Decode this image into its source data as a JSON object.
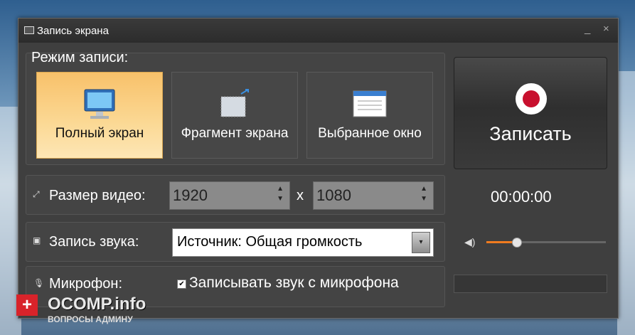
{
  "window": {
    "title": "Запись экрана",
    "minimize": "_",
    "close": "×"
  },
  "mode": {
    "label": "Режим записи:",
    "options": [
      {
        "label": "Полный экран",
        "icon": "monitor-icon",
        "active": true
      },
      {
        "label": "Фрагмент экрана",
        "icon": "screen-fragment-icon",
        "active": false
      },
      {
        "label": "Выбранное окно",
        "icon": "window-icon",
        "active": false
      }
    ]
  },
  "record": {
    "label": "Записать",
    "icon": "record-icon",
    "color": "#c8102e"
  },
  "video_size": {
    "label": "Размер видео:",
    "width": "1920",
    "height": "1080",
    "separator": "x"
  },
  "timer": "00:00:00",
  "audio": {
    "label": "Запись звука:",
    "source": "Источник: Общая громкость"
  },
  "volume": {
    "level": 0.25,
    "accent": "#f07b1f"
  },
  "mic": {
    "label": "Микрофон:",
    "checkbox_label": "Записывать звук с микрофона",
    "checked": true
  },
  "watermark": {
    "brand": "OCOMP.info",
    "subtitle": "ВОПРОСЫ АДМИНУ",
    "plus": "+"
  }
}
